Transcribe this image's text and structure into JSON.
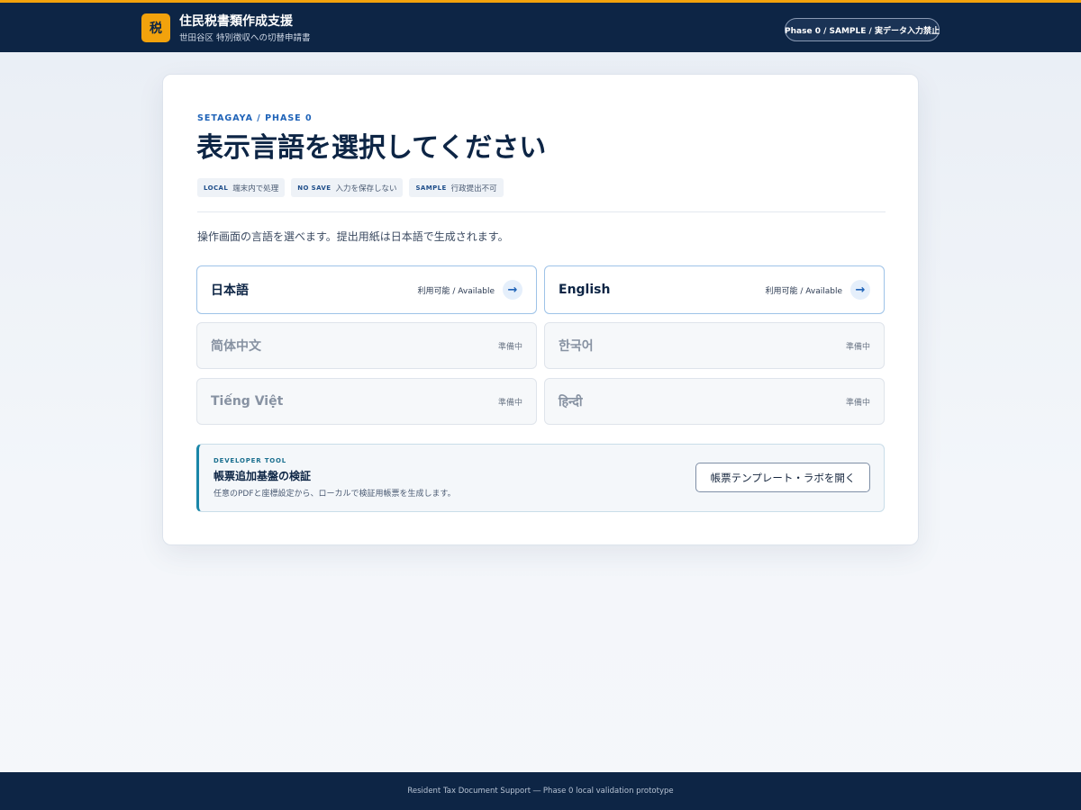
{
  "header": {
    "logo_text": "税",
    "title": "住民税書類作成支援",
    "subtitle": "世田谷区 特別徴収への切替申請書",
    "phase_badge": "Phase 0 / SAMPLE / 実データ入力禁止",
    "colors": {
      "background": "#0d2545",
      "accent": "#f2a20c"
    }
  },
  "main": {
    "eyebrow": "SETAGAYA / PHASE 0",
    "title": "表示言語を選択してください",
    "tags": [
      {
        "code": "LOCAL",
        "text": "端末内で処理"
      },
      {
        "code": "NO SAVE",
        "text": "入力を保存しない"
      },
      {
        "code": "SAMPLE",
        "text": "行政提出不可"
      }
    ],
    "intro": "操作画面の言語を選べます。提出用紙は日本語で生成されます。",
    "languages": [
      {
        "name": "日本語",
        "status": "利用可能 / Available",
        "available": true,
        "icon": "arrow-right-icon"
      },
      {
        "name": "English",
        "status": "利用可能 / Available",
        "available": true,
        "icon": "arrow-right-icon"
      },
      {
        "name": "简体中文",
        "status": "準備中",
        "available": false
      },
      {
        "name": "한국어",
        "status": "準備中",
        "available": false
      },
      {
        "name": "Tiếng Việt",
        "status": "準備中",
        "available": false
      },
      {
        "name": "हिन्दी",
        "status": "準備中",
        "available": false
      }
    ],
    "dev_tool": {
      "eyebrow": "DEVELOPER TOOL",
      "title": "帳票追加基盤の検証",
      "description": "任意のPDFと座標設定から、ローカルで検証用帳票を生成します。",
      "button_label": "帳票テンプレート・ラボを開く"
    }
  },
  "footer": {
    "text": "Resident Tax Document Support ― Phase 0 local validation prototype"
  }
}
